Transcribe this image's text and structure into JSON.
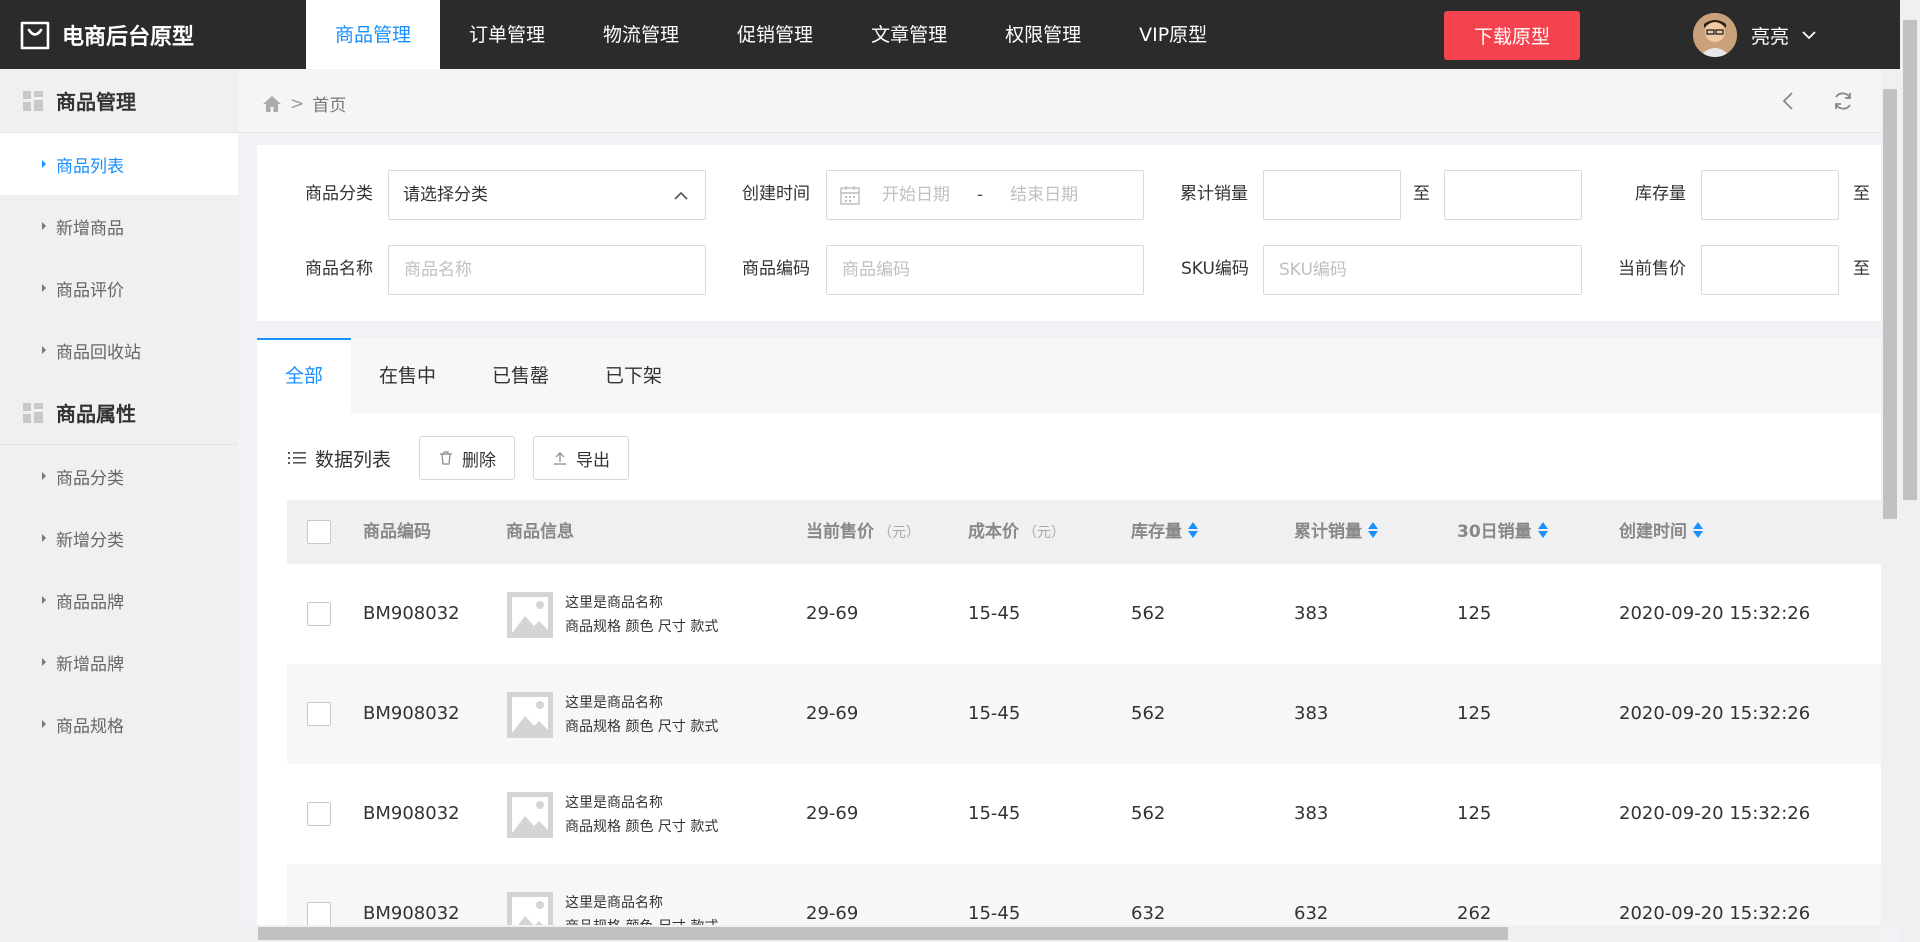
{
  "app": {
    "title": "电商后台原型",
    "download_label": "下载原型",
    "user_name": "亮亮"
  },
  "nav": [
    {
      "label": "商品管理",
      "active": true
    },
    {
      "label": "订单管理"
    },
    {
      "label": "物流管理"
    },
    {
      "label": "促销管理"
    },
    {
      "label": "文章管理"
    },
    {
      "label": "权限管理"
    },
    {
      "label": "VIP原型"
    }
  ],
  "sidebar": {
    "group1": "商品管理",
    "group1_items": [
      "商品列表",
      "新增商品",
      "商品评价",
      "商品回收站"
    ],
    "group2": "商品属性",
    "group2_items": [
      "商品分类",
      "新增分类",
      "商品品牌",
      "新增品牌",
      "商品规格"
    ]
  },
  "breadcrumb": {
    "current": "首页"
  },
  "filter": {
    "category_label": "商品分类",
    "category_value": "请选择分类",
    "created_label": "创建时间",
    "start_placeholder": "开始日期",
    "date_sep": "-",
    "end_placeholder": "结束日期",
    "sales_label": "累计销量",
    "to": "至",
    "stock_label": "库存量",
    "name_label": "商品名称",
    "name_placeholder": "商品名称",
    "code_label": "商品编码",
    "code_placeholder": "商品编码",
    "sku_label": "SKU编码",
    "sku_placeholder": "SKU编码",
    "price_label": "当前售价"
  },
  "tabs": [
    "全部",
    "在售中",
    "已售罄",
    "已下架"
  ],
  "toolbar": {
    "list_title": "数据列表",
    "delete_label": "删除",
    "export_label": "导出"
  },
  "table": {
    "headers": {
      "code": "商品编码",
      "info": "商品信息",
      "price": "当前售价",
      "cost": "成本价",
      "unit": "（元）",
      "stock": "库存量",
      "sales": "累计销量",
      "sales30": "30日销量",
      "created": "创建时间"
    },
    "rows": [
      {
        "code": "BM908032",
        "name": "这里是商品名称",
        "spec": "商品规格 颜色 尺寸 款式",
        "price": "29-69",
        "cost": "15-45",
        "stock": "562",
        "sales": "383",
        "sales30": "125",
        "created": "2020-09-20 15:32:26"
      },
      {
        "code": "BM908032",
        "name": "这里是商品名称",
        "spec": "商品规格 颜色 尺寸 款式",
        "price": "29-69",
        "cost": "15-45",
        "stock": "562",
        "sales": "383",
        "sales30": "125",
        "created": "2020-09-20 15:32:26"
      },
      {
        "code": "BM908032",
        "name": "这里是商品名称",
        "spec": "商品规格 颜色 尺寸 款式",
        "price": "29-69",
        "cost": "15-45",
        "stock": "562",
        "sales": "383",
        "sales30": "125",
        "created": "2020-09-20 15:32:26"
      },
      {
        "code": "BM908032",
        "name": "这里是商品名称",
        "spec": "商品规格 颜色 尺寸 款式",
        "price": "29-69",
        "cost": "15-45",
        "stock": "632",
        "sales": "632",
        "sales30": "262",
        "created": "2020-09-20 15:32:26"
      }
    ]
  },
  "colors": {
    "accent": "#1890ff",
    "topbar": "#2b2b2b",
    "download": "#f5424f"
  }
}
